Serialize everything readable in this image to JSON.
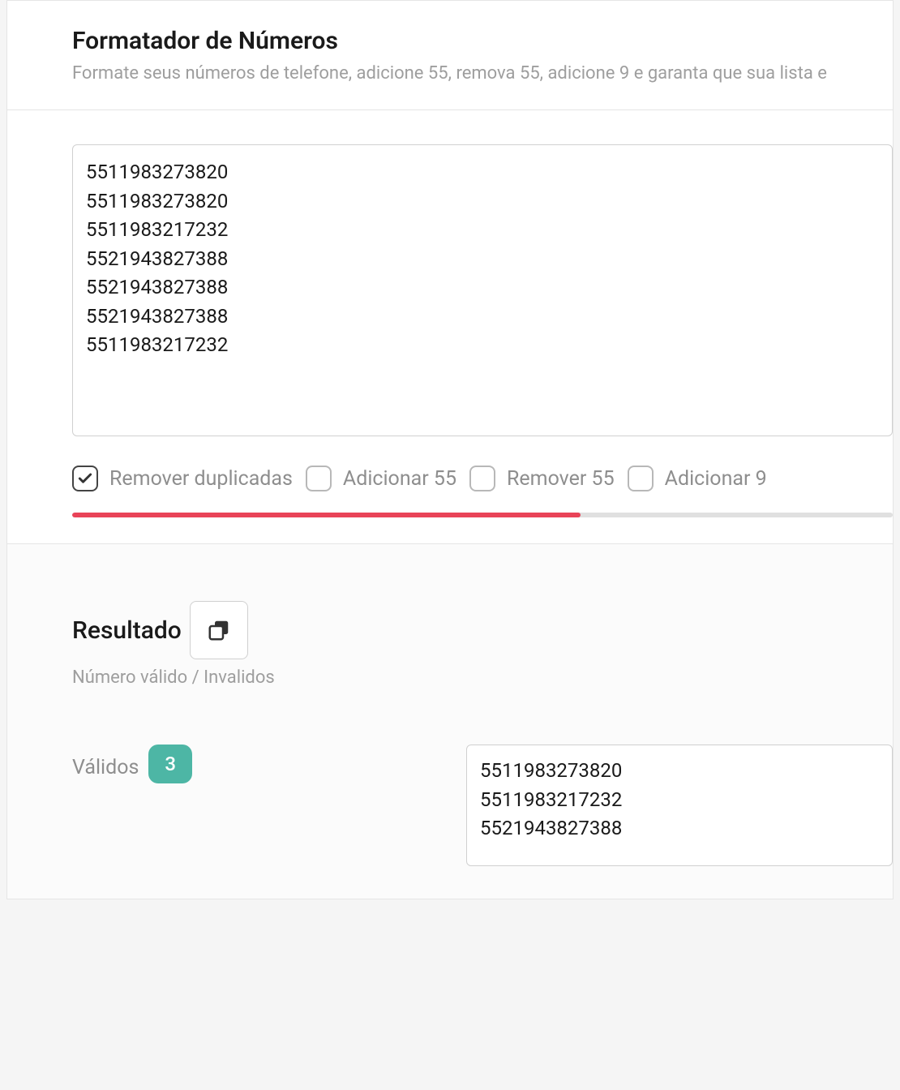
{
  "header": {
    "title": "Formatador de Números",
    "subtitle": "Formate seus números de telefone, adicione 55, remova 55, adicione 9 e garanta que sua lista e"
  },
  "input": {
    "numbers": "5511983273820\n5511983273820\n5511983217232\n5521943827388\n5521943827388\n5521943827388\n5511983217232"
  },
  "options": {
    "remove_duplicates": {
      "label": "Remover duplicadas",
      "checked": true
    },
    "add_55": {
      "label": "Adicionar 55",
      "checked": false
    },
    "remove_55": {
      "label": "Remover 55",
      "checked": false
    },
    "add_9": {
      "label": "Adicionar 9",
      "checked": false
    }
  },
  "progress": {
    "percent": 62
  },
  "result": {
    "title": "Resultado",
    "subtitle": "Número válido / Invalidos",
    "valid_label": "Válidos",
    "valid_count": "3",
    "valid_numbers": "5511983273820\n5511983217232\n5521943827388"
  }
}
